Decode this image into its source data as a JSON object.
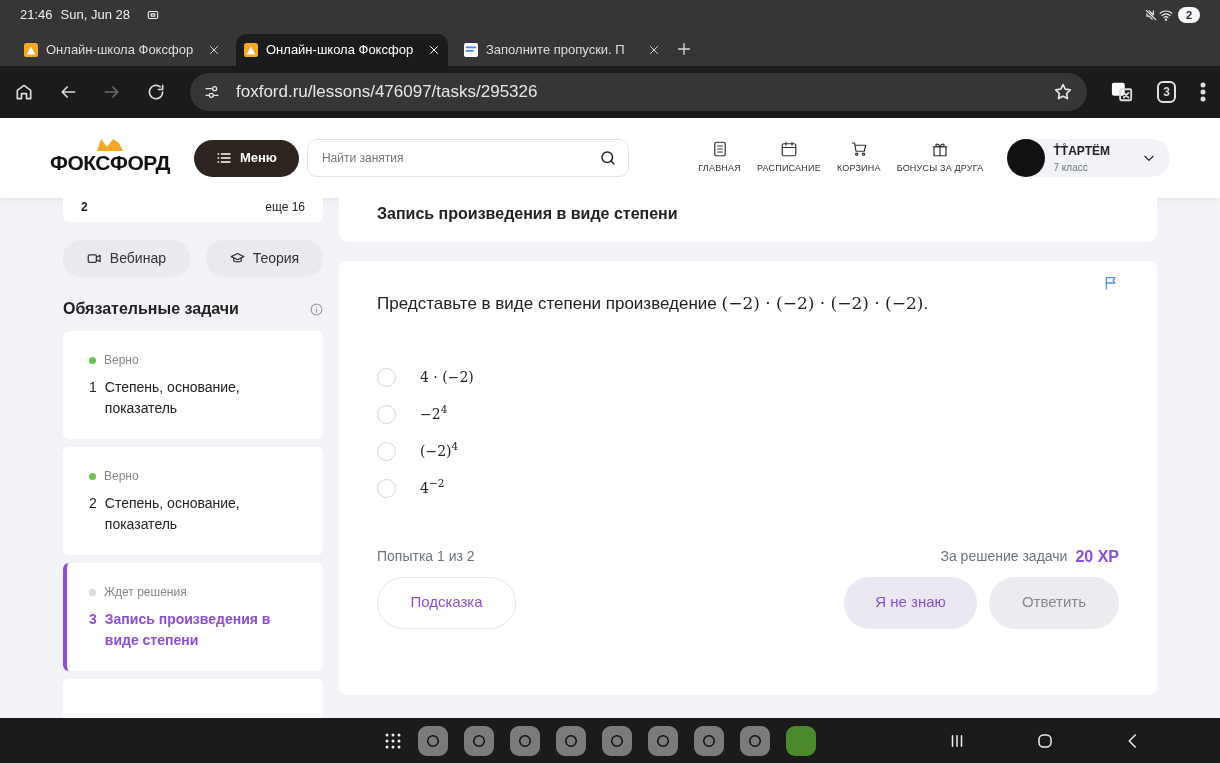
{
  "status_bar": {
    "time": "21:46",
    "date": "Sun, Jun 28",
    "notification_count": "2"
  },
  "browser_tabs": [
    {
      "title": "Онлайн-школа Фоксфор",
      "selected": false,
      "kind": "site"
    },
    {
      "title": "Онлайн-школа Фоксфор",
      "selected": true,
      "kind": "site"
    },
    {
      "title": "Заполните пропуски. П",
      "selected": false,
      "kind": "doc"
    }
  ],
  "address_bar": {
    "url": "foxford.ru/lessons/476097/tasks/295326",
    "tab_count": "3"
  },
  "site_header": {
    "logo": "ФОКСФОРД",
    "menu_button": "Меню",
    "search": {
      "placeholder": "Найти занятия"
    },
    "nav": [
      {
        "label": "ГЛАВНАЯ",
        "kind": "home"
      },
      {
        "label": "РАСПИСАНИЕ",
        "kind": "calendar"
      },
      {
        "label": "КОРЗИНА",
        "kind": "cart"
      },
      {
        "label": "БОНУСЫ ЗА ДРУГА",
        "kind": "gift"
      }
    ],
    "profile": {
      "name": "T̊T̊АРТЁМ",
      "grade": "7 класс"
    }
  },
  "sidebar": {
    "progress": {
      "count": "2",
      "more": "еще 16"
    },
    "buttons": [
      {
        "label": "Вебинар",
        "kind": "video"
      },
      {
        "label": "Теория",
        "kind": "theory"
      }
    ],
    "section_title": "Обязательные задачи",
    "tasks": [
      {
        "status": "Верно",
        "color": "#6cc24a",
        "number": "1",
        "title": "Степень, основание, показатель",
        "selected": false
      },
      {
        "status": "Верно",
        "color": "#6cc24a",
        "number": "2",
        "title": "Степень, основание, показатель",
        "selected": false
      },
      {
        "status": "Ждет решения",
        "color": "#d9d9de",
        "number": "3",
        "title": "Запись произведения в виде степени",
        "selected": true
      }
    ]
  },
  "task_header": {
    "title": "Запись произведения в виде степени"
  },
  "task": {
    "question": "Представьте в виде степени произведение",
    "expression": "(−2) · (−2) · (−2) · (−2)",
    "end": ".",
    "options": [
      {
        "label": "4 · (−2)",
        "selected": false
      },
      {
        "label": "−2$^{4}$",
        "selected": false
      },
      {
        "label": "(−2)$^{4}$",
        "selected": false
      },
      {
        "label": "4$^{−2}$",
        "selected": false
      }
    ],
    "attempt": "Попытка 1 из 2",
    "reward_label": "За решение задачи",
    "reward": "20 XP",
    "hint_button": "Подсказка",
    "dont_know_button": "Я не знаю",
    "answer_button": "Ответить"
  }
}
